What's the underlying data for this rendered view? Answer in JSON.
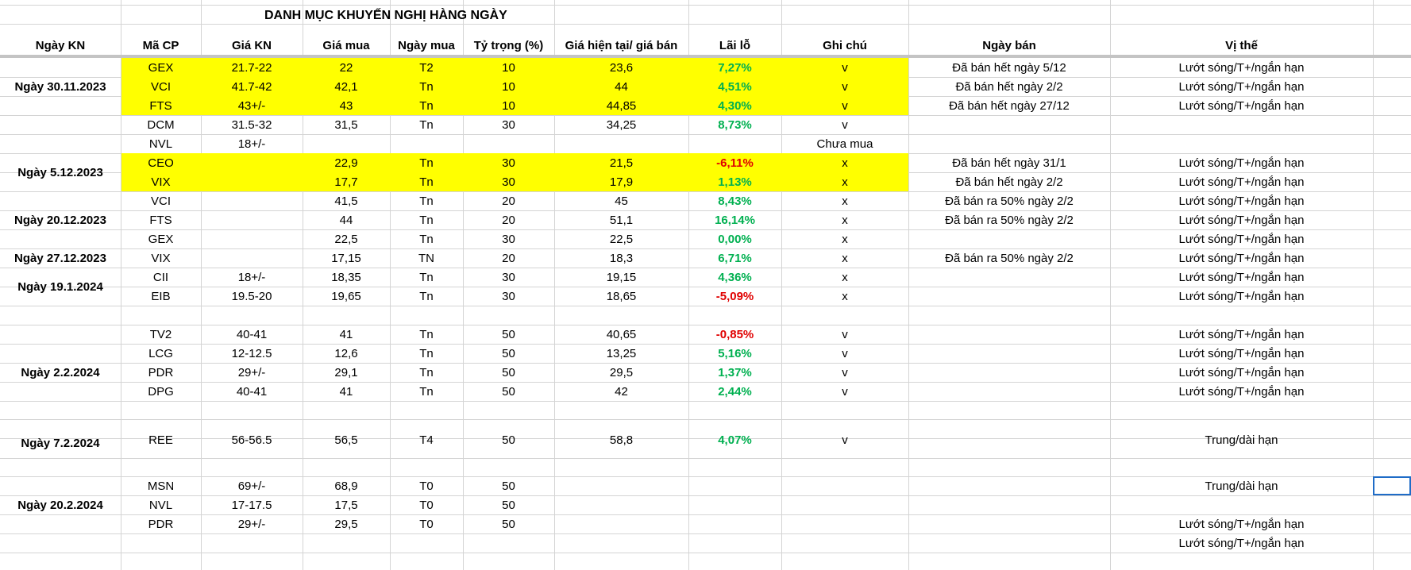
{
  "sheet": {
    "title": "DANH MỤC KHUYẾN NGHỊ HÀNG NGÀY",
    "headers": [
      "Ngày KN",
      "Mã CP",
      "Giá KN",
      "Giá mua",
      "Ngày mua",
      "Tỷ trọng (%)",
      "Giá hiện tại/ giá bán",
      "Lãi lỗ",
      "Ghi chú",
      "Ngày bán",
      "Vị thế"
    ],
    "date_groups": [
      "Ngày 30.11.2023",
      "Ngày 5.12.2023",
      "Ngày 20.12.2023",
      "Ngày 27.12.2023",
      "Ngày 19.1.2024",
      "Ngày 2.2.2024",
      "Ngày 7.2.2024",
      "Ngày 20.2.2024"
    ],
    "rows": [
      {
        "ma": "GEX",
        "gia_kn": "21.7-22",
        "gia_mua": "22",
        "ngay_mua": "T2",
        "ty_trong": "10",
        "gia_ht": "23,6",
        "lai_lo": "7,27%",
        "ghi_chu": "v",
        "ngay_ban": "Đã bán hết ngày 5/12",
        "vi_the": "Lướt sóng/T+/ngắn hạn"
      },
      {
        "ma": "VCI",
        "gia_kn": "41.7-42",
        "gia_mua": "42,1",
        "ngay_mua": "Tn",
        "ty_trong": "10",
        "gia_ht": "44",
        "lai_lo": "4,51%",
        "ghi_chu": "v",
        "ngay_ban": "Đã bán hết ngày 2/2",
        "vi_the": "Lướt sóng/T+/ngắn hạn"
      },
      {
        "ma": "FTS",
        "gia_kn": "43+/-",
        "gia_mua": "43",
        "ngay_mua": "Tn",
        "ty_trong": "10",
        "gia_ht": "44,85",
        "lai_lo": "4,30%",
        "ghi_chu": "v",
        "ngay_ban": "Đã bán hết ngày 27/12",
        "vi_the": "Lướt sóng/T+/ngắn hạn"
      },
      {
        "ma": "DCM",
        "gia_kn": "31.5-32",
        "gia_mua": "31,5",
        "ngay_mua": "Tn",
        "ty_trong": "30",
        "gia_ht": "34,25",
        "lai_lo": "8,73%",
        "ghi_chu": "v",
        "ngay_ban": "",
        "vi_the": ""
      },
      {
        "ma": "NVL",
        "gia_kn": "18+/-",
        "gia_mua": "",
        "ngay_mua": "",
        "ty_trong": "",
        "gia_ht": "",
        "lai_lo": "",
        "ghi_chu": "Chưa mua",
        "ngay_ban": "",
        "vi_the": ""
      },
      {
        "ma": "CEO",
        "gia_kn": "",
        "gia_mua": "22,9",
        "ngay_mua": "Tn",
        "ty_trong": "30",
        "gia_ht": "21,5",
        "lai_lo": "-6,11%",
        "ghi_chu": "x",
        "ngay_ban": "Đã bán hết ngày 31/1",
        "vi_the": "Lướt sóng/T+/ngắn hạn"
      },
      {
        "ma": "VIX",
        "gia_kn": "",
        "gia_mua": "17,7",
        "ngay_mua": "Tn",
        "ty_trong": "30",
        "gia_ht": "17,9",
        "lai_lo": "1,13%",
        "ghi_chu": "x",
        "ngay_ban": "Đã bán hết ngày 2/2",
        "vi_the": "Lướt sóng/T+/ngắn hạn"
      },
      {
        "ma": "VCI",
        "gia_kn": "",
        "gia_mua": "41,5",
        "ngay_mua": "Tn",
        "ty_trong": "20",
        "gia_ht": "45",
        "lai_lo": "8,43%",
        "ghi_chu": "x",
        "ngay_ban": "Đã bán ra 50% ngày 2/2",
        "vi_the": "Lướt sóng/T+/ngắn hạn"
      },
      {
        "ma": "FTS",
        "gia_kn": "",
        "gia_mua": "44",
        "ngay_mua": "Tn",
        "ty_trong": "20",
        "gia_ht": "51,1",
        "lai_lo": "16,14%",
        "ghi_chu": "x",
        "ngay_ban": "Đã bán ra 50% ngày 2/2",
        "vi_the": "Lướt sóng/T+/ngắn hạn"
      },
      {
        "ma": "GEX",
        "gia_kn": "",
        "gia_mua": "22,5",
        "ngay_mua": "Tn",
        "ty_trong": "30",
        "gia_ht": "22,5",
        "lai_lo": "0,00%",
        "ghi_chu": "x",
        "ngay_ban": "",
        "vi_the": "Lướt sóng/T+/ngắn hạn"
      },
      {
        "ma": "VIX",
        "gia_kn": "",
        "gia_mua": "17,15",
        "ngay_mua": "TN",
        "ty_trong": "20",
        "gia_ht": "18,3",
        "lai_lo": "6,71%",
        "ghi_chu": "x",
        "ngay_ban": "Đã bán ra 50% ngày 2/2",
        "vi_the": "Lướt sóng/T+/ngắn hạn"
      },
      {
        "ma": "CII",
        "gia_kn": "18+/-",
        "gia_mua": "18,35",
        "ngay_mua": "Tn",
        "ty_trong": "30",
        "gia_ht": "19,15",
        "lai_lo": "4,36%",
        "ghi_chu": "x",
        "ngay_ban": "",
        "vi_the": "Lướt sóng/T+/ngắn hạn"
      },
      {
        "ma": "EIB",
        "gia_kn": "19.5-20",
        "gia_mua": "19,65",
        "ngay_mua": "Tn",
        "ty_trong": "30",
        "gia_ht": "18,65",
        "lai_lo": "-5,09%",
        "ghi_chu": "x",
        "ngay_ban": "",
        "vi_the": "Lướt sóng/T+/ngắn hạn"
      },
      {
        "ma": "TV2",
        "gia_kn": "40-41",
        "gia_mua": "41",
        "ngay_mua": "Tn",
        "ty_trong": "50",
        "gia_ht": "40,65",
        "lai_lo": "-0,85%",
        "ghi_chu": "v",
        "ngay_ban": "",
        "vi_the": "Lướt sóng/T+/ngắn hạn"
      },
      {
        "ma": "LCG",
        "gia_kn": "12-12.5",
        "gia_mua": "12,6",
        "ngay_mua": "Tn",
        "ty_trong": "50",
        "gia_ht": "13,25",
        "lai_lo": "5,16%",
        "ghi_chu": "v",
        "ngay_ban": "",
        "vi_the": "Lướt sóng/T+/ngắn hạn"
      },
      {
        "ma": "PDR",
        "gia_kn": "29+/-",
        "gia_mua": "29,1",
        "ngay_mua": "Tn",
        "ty_trong": "50",
        "gia_ht": "29,5",
        "lai_lo": "1,37%",
        "ghi_chu": "v",
        "ngay_ban": "",
        "vi_the": "Lướt sóng/T+/ngắn hạn"
      },
      {
        "ma": "DPG",
        "gia_kn": "40-41",
        "gia_mua": "41",
        "ngay_mua": "Tn",
        "ty_trong": "50",
        "gia_ht": "42",
        "lai_lo": "2,44%",
        "ghi_chu": "v",
        "ngay_ban": "",
        "vi_the": "Lướt sóng/T+/ngắn hạn"
      },
      {
        "ma": "REE",
        "gia_kn": "56-56.5",
        "gia_mua": "56,5",
        "ngay_mua": "T4",
        "ty_trong": "50",
        "gia_ht": "58,8",
        "lai_lo": "4,07%",
        "ghi_chu": "v",
        "ngay_ban": "",
        "vi_the": "Trung/dài hạn"
      },
      {
        "ma": "MSN",
        "gia_kn": "69+/-",
        "gia_mua": "68,9",
        "ngay_mua": "T0",
        "ty_trong": "50",
        "gia_ht": "",
        "lai_lo": "",
        "ghi_chu": "",
        "ngay_ban": "",
        "vi_the": "Trung/dài hạn"
      },
      {
        "ma": "NVL",
        "gia_kn": "17-17.5",
        "gia_mua": "17,5",
        "ngay_mua": "T0",
        "ty_trong": "50",
        "gia_ht": "",
        "lai_lo": "",
        "ghi_chu": "",
        "ngay_ban": "",
        "vi_the": ""
      },
      {
        "ma": "PDR",
        "gia_kn": "29+/-",
        "gia_mua": "29,5",
        "ngay_mua": "T0",
        "ty_trong": "50",
        "gia_ht": "",
        "lai_lo": "",
        "ghi_chu": "",
        "ngay_ban": "",
        "vi_the": "Lướt sóng/T+/ngắn hạn"
      }
    ],
    "extra_vi_the": "Lướt sóng/T+/ngắn hạn"
  },
  "colors": {
    "highlight": "#ffff00",
    "profit": "#00b050",
    "loss": "#e00000",
    "grid": "#d4d4d4",
    "selection": "#1f6cc7"
  }
}
